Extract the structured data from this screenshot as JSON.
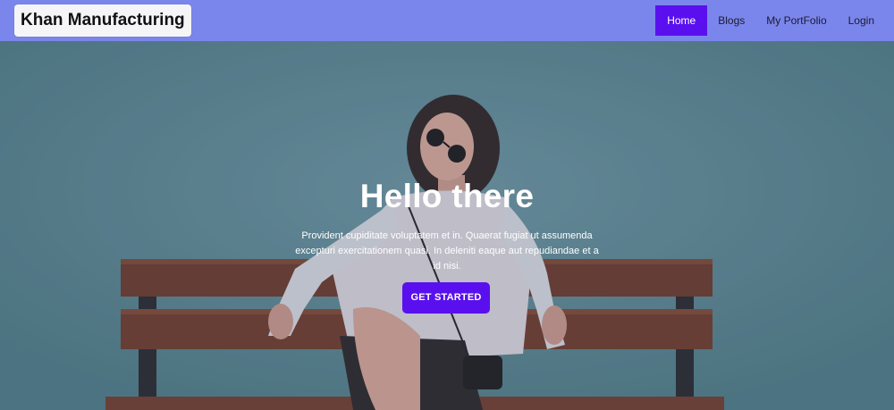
{
  "brand": {
    "name": "Khan Manufacturing"
  },
  "nav": {
    "items": [
      {
        "label": "Home",
        "active": true
      },
      {
        "label": "Blogs",
        "active": false
      },
      {
        "label": "My PortFolio",
        "active": false
      },
      {
        "label": "Login",
        "active": false
      }
    ]
  },
  "hero": {
    "title": "Hello there",
    "text": "Provident cupiditate voluptatem et in. Quaerat fugiat ut assumenda excepturi exercitationem quasi. In deleniti eaque aut repudiandae et a id nisi.",
    "cta_label": "GET STARTED",
    "image": "woman-in-sunglasses-on-bench"
  },
  "colors": {
    "navbar": "#7b86ec",
    "accent": "#5a10ee",
    "hero_bg": "#5a848c"
  }
}
